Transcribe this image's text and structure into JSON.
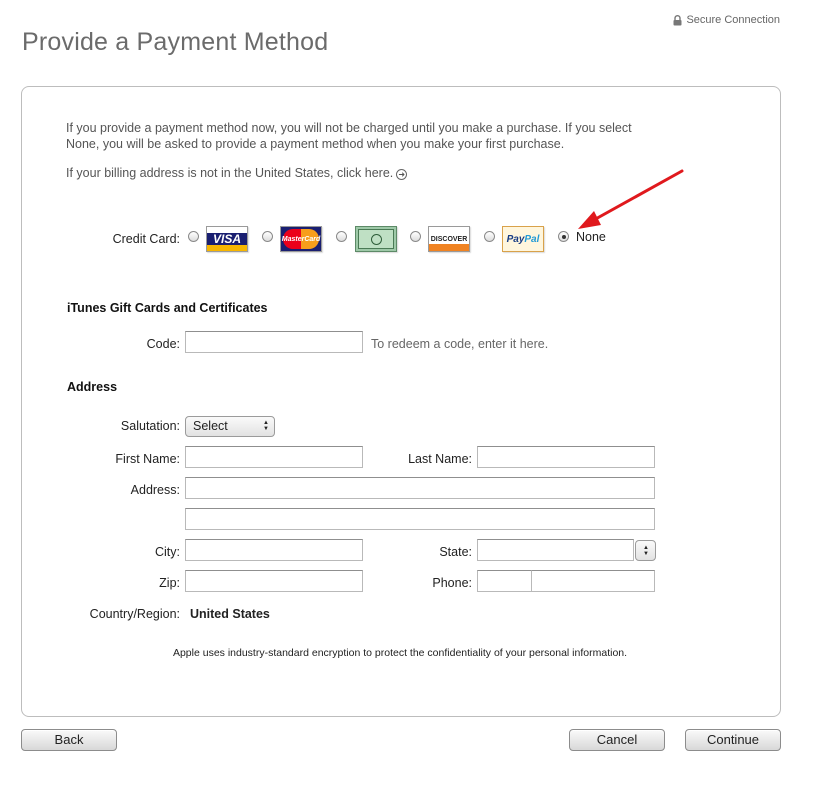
{
  "header": {
    "secure_label": "Secure Connection",
    "title": "Provide a Payment Method"
  },
  "intro": {
    "text": "If you provide a payment method now, you will not be charged until you make a purchase. If you select None, you will be asked to provide a payment method when you make your first purchase.",
    "billing_text": "If your billing address is not in the United States, click here."
  },
  "payment": {
    "credit_card_label": "Credit Card:",
    "cards": [
      {
        "name": "visa",
        "text": "VISA",
        "selected": false
      },
      {
        "name": "mastercard",
        "text": "MasterCard",
        "selected": false
      },
      {
        "name": "amex",
        "text": "",
        "selected": false
      },
      {
        "name": "discover",
        "text": "DISCOVER",
        "selected": false
      },
      {
        "name": "paypal",
        "text_a": "Pay",
        "text_b": "Pal",
        "selected": false
      }
    ],
    "none_label": "None",
    "none_selected": true
  },
  "gift": {
    "heading": "iTunes Gift Cards and Certificates",
    "code_label": "Code:",
    "code_value": "",
    "hint": "To redeem a code, enter it here."
  },
  "address": {
    "heading": "Address",
    "salutation_label": "Salutation:",
    "salutation_value": "Select",
    "first_name_label": "First Name:",
    "first_name_value": "",
    "last_name_label": "Last Name:",
    "last_name_value": "",
    "address_label": "Address:",
    "address_line1": "",
    "address_line2": "",
    "city_label": "City:",
    "city_value": "",
    "state_label": "State:",
    "state_value": "",
    "zip_label": "Zip:",
    "zip_value": "",
    "phone_label": "Phone:",
    "phone_area": "",
    "phone_number": "",
    "country_label": "Country/Region:",
    "country_value": "United States"
  },
  "footer": {
    "encryption_note": "Apple uses industry-standard encryption to protect the confidentiality of your personal information.",
    "back_label": "Back",
    "cancel_label": "Cancel",
    "continue_label": "Continue"
  },
  "colors": {
    "annotation_arrow": "#e0191d",
    "title_gray": "#6b6b6b"
  }
}
